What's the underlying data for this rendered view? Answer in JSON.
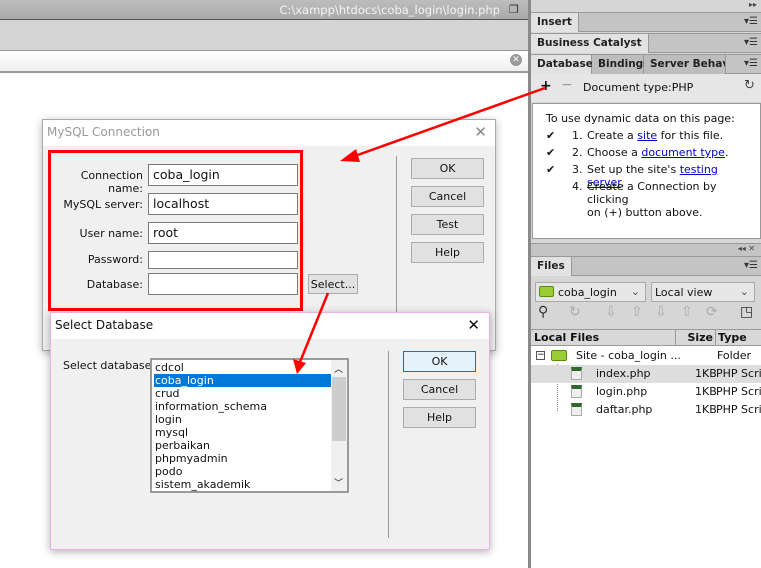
{
  "editor": {
    "file_path": "C:\\xampp\\htdocs\\coba_login\\login.php"
  },
  "panels": {
    "insert": "Insert",
    "business_catalyst": "Business Catalyst",
    "tabs": [
      "Databases",
      "Bindings",
      "Server Behaviors"
    ],
    "doc_type": "Document type:PHP",
    "intro": "To use dynamic data on this page:",
    "steps": [
      {
        "num": "1.",
        "pre": "Create a ",
        "link": "site",
        "post": " for this file.",
        "checked": true
      },
      {
        "num": "2.",
        "pre": "Choose a ",
        "link": "document type",
        "post": ".",
        "checked": true
      },
      {
        "num": "3.",
        "pre": "Set up the site's ",
        "link": "testing server",
        "post": ".",
        "checked": true
      },
      {
        "num": "4.",
        "pre": "Create a Connection by clicking",
        "line2": "on (+) button above.",
        "checked": false
      }
    ],
    "check": "✔"
  },
  "files": {
    "tab": "Files",
    "site": "coba_login",
    "view": "Local view",
    "columns": [
      "Local Files",
      "Size",
      "Type"
    ],
    "root": {
      "name": "Site - coba_login ...",
      "type": "Folder"
    },
    "items": [
      {
        "name": "index.php",
        "size": "1KB",
        "type": "PHP Script"
      },
      {
        "name": "login.php",
        "size": "1KB",
        "type": "PHP Script"
      },
      {
        "name": "daftar.php",
        "size": "1KB",
        "type": "PHP Script"
      }
    ]
  },
  "mysql": {
    "title": "MySQL Connection",
    "fields": [
      {
        "label": "Connection name:",
        "value": "coba_login"
      },
      {
        "label": "MySQL server:",
        "value": "localhost"
      },
      {
        "label": "User name:",
        "value": "root"
      },
      {
        "label": "Password:",
        "value": ""
      },
      {
        "label": "Database:",
        "value": ""
      }
    ],
    "select_btn": "Select...",
    "buttons": [
      "OK",
      "Cancel",
      "Test",
      "Help"
    ]
  },
  "selectdb": {
    "title": "Select Database",
    "label": "Select database:",
    "options": [
      "cdcol",
      "coba_login",
      "crud",
      "information_schema",
      "login",
      "mysql",
      "perbaikan",
      "phpmyadmin",
      "podo",
      "sistem_akademik"
    ],
    "selected": "coba_login",
    "buttons": [
      "OK",
      "Cancel",
      "Help"
    ]
  },
  "colors": {
    "annotation": "#ff0000",
    "selection": "#0078d7",
    "link": "#0000cc"
  }
}
